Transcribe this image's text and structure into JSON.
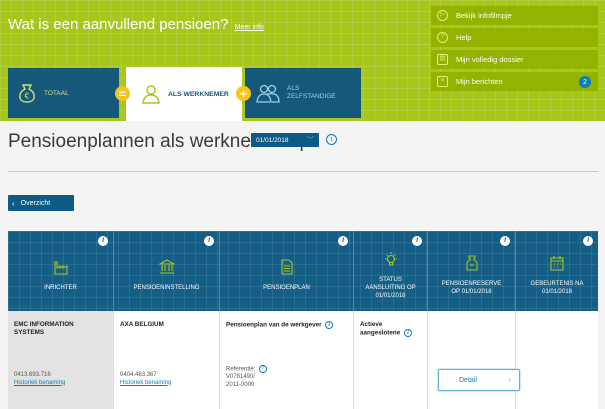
{
  "header": {
    "title": "Wat is een aanvullend pensioen?",
    "title_link": "Meer info"
  },
  "side_menu": {
    "items": [
      {
        "label": "Bekijk infofilmpje",
        "icon": "play-icon"
      },
      {
        "label": "Help",
        "icon": "help-icon"
      },
      {
        "label": "Mijn volledig dossier",
        "icon": "folder-icon"
      },
      {
        "label": "Mijn berichten",
        "icon": "document-icon",
        "badge": "2"
      }
    ]
  },
  "tabs": [
    {
      "label": "TOTAAL",
      "icon": "money-bag-icon"
    },
    {
      "label": "ALS WERKNEMER",
      "icon": "person-icon",
      "active": true
    },
    {
      "label_line1": "ALS",
      "label_line2": "ZELFSTANDIGE",
      "icon": "people-icon"
    }
  ],
  "operators": [
    "=",
    "+"
  ],
  "page": {
    "title": "Pensioenplannen als werknemer op",
    "date": "01/01/2018",
    "info": "i"
  },
  "overzicht_label": "Overzicht",
  "table": {
    "headers": [
      {
        "label": "INRICHTER",
        "icon": "factory-icon"
      },
      {
        "label": "PENSIOENINSTELLING",
        "icon": "bank-icon"
      },
      {
        "label": "PENSIOENPLAN",
        "icon": "document-icon"
      },
      {
        "line1": "STATUS",
        "line2": "AANSLUITING OP",
        "line3": "01/01/2018",
        "icon": "lightbulb-icon"
      },
      {
        "line1": "PENSIOENRESERVE",
        "line2": "OP 01/01/2018",
        "icon": "jar-icon"
      },
      {
        "line1": "GEBEURTENIS NA",
        "line2": "01/01/2018",
        "icon": "calendar-icon"
      }
    ],
    "row": {
      "inrichter_name_1": "EMC INFORMATION",
      "inrichter_name_2": "SYSTEMS",
      "inrichter_number": "0413.693.716",
      "inrichter_history": "Historiek benaming",
      "instelling_name": "AXA BELGIUM",
      "instelling_number": "0404.483.367",
      "instelling_history": "Historiek benaming",
      "plan_name": "Pensioenplan van de werkgever",
      "plan_ref_label": "Referentie:",
      "plan_ref_1": "V0781490/",
      "plan_ref_2": "2011-0000",
      "status_1": "Actieve",
      "status_2": "aangeslotene",
      "detail_label": "Detail"
    }
  },
  "colors": {
    "header_green": "#a7c61c",
    "menu_green": "#93b300",
    "navy": "#155e85",
    "accent_yellow": "#f4c51c",
    "link_blue": "#0a7fb5"
  }
}
